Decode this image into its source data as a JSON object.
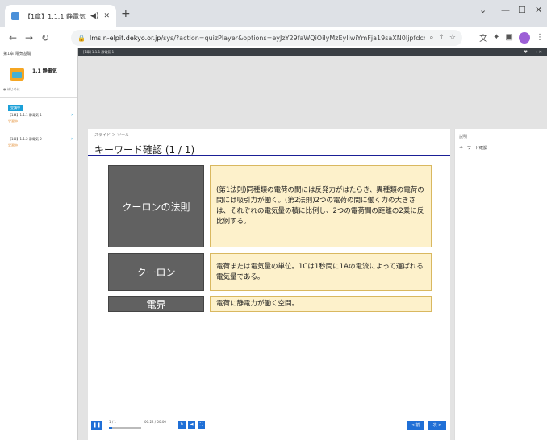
{
  "browser": {
    "tab_title": "【1章】1.1.1 静電気 1",
    "url_prefix": "lms.n-elpit.dekyo.or.jp",
    "url_rest": "/sys/?action=quizPlayer&options=eyJzY29faWQiOiIyMzEyIiwiYmFja19saXN0IjpfdcnVlLCJoZWFkZXIiOn..."
  },
  "player": {
    "header_title": "[1章] 1.1.1 静電気 1"
  },
  "sidebar": {
    "chapter_label": "第1章 電気基礎",
    "course_title": "1.1 静電気",
    "status_label": "● はじめに",
    "badge": "受講中",
    "items": [
      {
        "label": "【1章】1.1.1 静電気 1",
        "status": "学習中"
      },
      {
        "label": "【1章】1.1.2 静電気 2",
        "status": "学習中"
      }
    ]
  },
  "slide": {
    "breadcrumb": "スライド ＞ ツール",
    "title": "キーワード確認 (1 / 1)",
    "terms": [
      {
        "term": "クーロンの法則",
        "description": "(第1法則)同種類の電荷の間には反発力がはたらき、異種類の電荷の間には吸引力が働く。(第2法則)2つの電荷の間に働く力の大きさは、それぞれの電気量の積に比例し、2つの電荷間の距離の2乗に反比例する。"
      },
      {
        "term": "クーロン",
        "description": "電荷または電気量の単位。1Cは1秒間に1Aの電流によって運ばれる電気量である。"
      },
      {
        "term": "電界",
        "description": "電荷に静電力が働く空間。"
      }
    ]
  },
  "controls": {
    "page": "1 / 1",
    "time": "00:22 / 00:00",
    "progress": 0.1,
    "prev_label": "< 前",
    "next_label": "次 >"
  },
  "right_panel": {
    "label": "説明",
    "text": "キーワード確認"
  }
}
